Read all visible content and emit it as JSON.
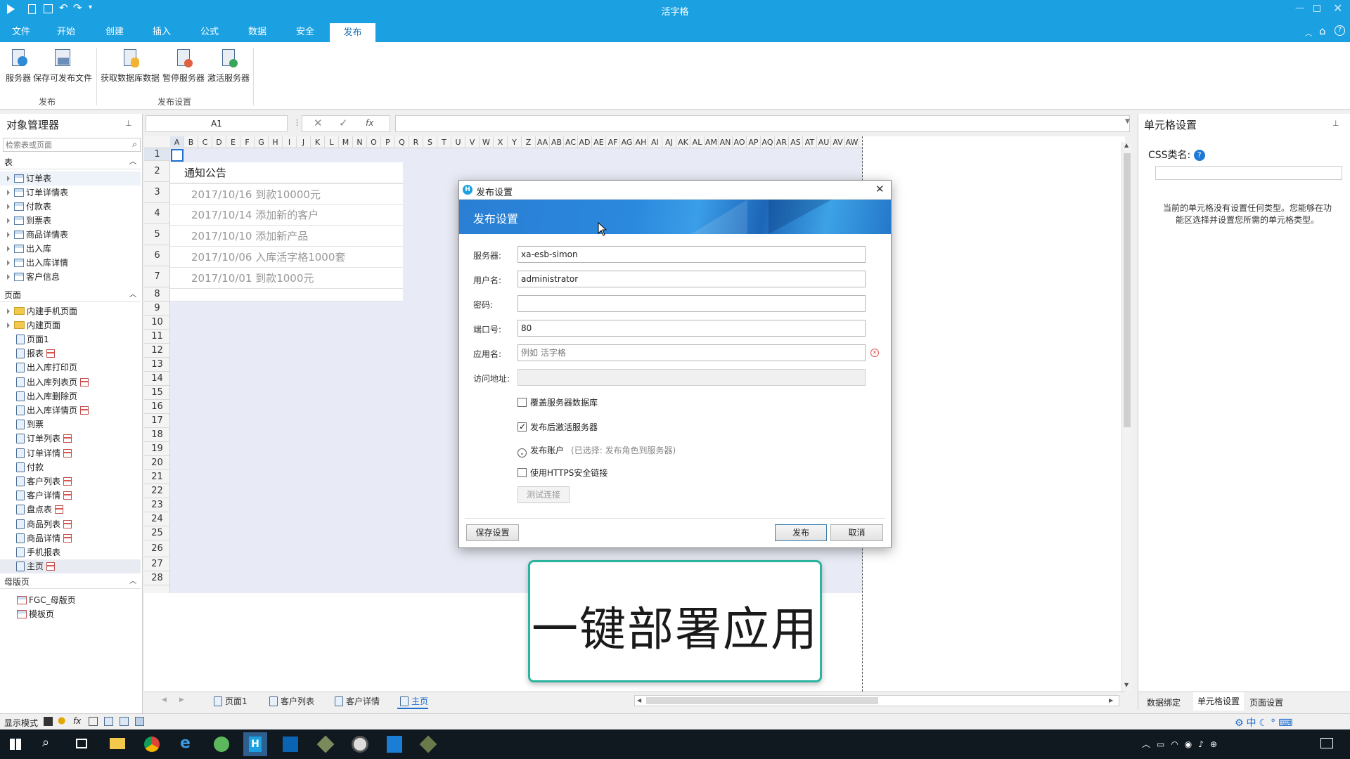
{
  "app": {
    "title": "活字格"
  },
  "ribbon": {
    "tabs": [
      "文件",
      "开始",
      "创建",
      "插入",
      "公式",
      "数据",
      "安全",
      "发布"
    ],
    "active_tab": "发布",
    "groups": [
      {
        "caption": "发布",
        "buttons": [
          "服务器",
          "保存可发布文件"
        ]
      },
      {
        "caption": "发布设置",
        "buttons": [
          "获取数据库数据",
          "暂停服务器",
          "激活服务器"
        ]
      }
    ]
  },
  "object_manager": {
    "title": "对象管理器",
    "search_placeholder": "检索表或页面",
    "sections": {
      "tables": {
        "label": "表",
        "items": [
          "订单表",
          "订单详情表",
          "付款表",
          "到票表",
          "商品详情表",
          "出入库",
          "出入库详情",
          "客户信息"
        ]
      },
      "pages": {
        "label": "页面",
        "folders": [
          "内建手机页面",
          "内建页面"
        ],
        "items": [
          {
            "label": "页面1",
            "report": false
          },
          {
            "label": "报表",
            "report": true
          },
          {
            "label": "出入库打印页",
            "report": false
          },
          {
            "label": "出入库列表页",
            "report": true
          },
          {
            "label": "出入库删除页",
            "report": false
          },
          {
            "label": "出入库详情页",
            "report": true
          },
          {
            "label": "到票",
            "report": false
          },
          {
            "label": "订单列表",
            "report": true
          },
          {
            "label": "订单详情",
            "report": true
          },
          {
            "label": "付款",
            "report": false
          },
          {
            "label": "客户列表",
            "report": true
          },
          {
            "label": "客户详情",
            "report": true
          },
          {
            "label": "盘点表",
            "report": true
          },
          {
            "label": "商品列表",
            "report": true
          },
          {
            "label": "商品详情",
            "report": true
          },
          {
            "label": "手机报表",
            "report": false
          },
          {
            "label": "主页",
            "report": true
          }
        ]
      },
      "masters": {
        "label": "母版页",
        "items": [
          "FGC_母版页",
          "模板页"
        ]
      }
    }
  },
  "formula_bar": {
    "cell_ref": "A1",
    "fx": "fx"
  },
  "sheet": {
    "columns": [
      "A",
      "B",
      "C",
      "D",
      "E",
      "F",
      "G",
      "H",
      "I",
      "J",
      "K",
      "L",
      "M",
      "N",
      "O",
      "P",
      "Q",
      "R",
      "S",
      "T",
      "U",
      "V",
      "W",
      "X",
      "Y",
      "Z",
      "AA",
      "AB",
      "AC",
      "AD",
      "AE",
      "AF",
      "AG",
      "AH",
      "AI",
      "AJ",
      "AK",
      "AL",
      "AM",
      "AN",
      "AO",
      "AP",
      "AQ",
      "AR",
      "AS",
      "AT",
      "AU",
      "AV",
      "AW"
    ],
    "rows": [
      "1",
      "2",
      "3",
      "4",
      "5",
      "6",
      "7",
      "8",
      "9",
      "10",
      "11",
      "12",
      "13",
      "14",
      "15",
      "16",
      "17",
      "18",
      "19",
      "20",
      "21",
      "22",
      "23",
      "24",
      "25",
      "26",
      "27",
      "28"
    ],
    "notice_title": "通知公告",
    "notices": [
      "2017/10/16 到款10000元",
      "2017/10/14 添加新的客户",
      "2017/10/10 添加新产品",
      "2017/10/06 入库活字格1000套",
      "2017/10/01 到款1000元"
    ]
  },
  "sheet_tabs": [
    "页面1",
    "客户列表",
    "客户详情",
    "主页"
  ],
  "active_sheet_tab": "主页",
  "right_panel": {
    "title": "单元格设置",
    "css_label": "CSS类名:",
    "hint": "当前的单元格没有设置任何类型。您能够在功能区选择并设置您所需的单元格类型。",
    "bottom_tabs": [
      "数据绑定",
      "单元格设置",
      "页面设置"
    ]
  },
  "status": {
    "mode_label": "显示模式"
  },
  "dialog": {
    "window_title": "发布设置",
    "banner_title": "发布设置",
    "fields": {
      "server": {
        "label": "服务器:",
        "value": "xa-esb-simon"
      },
      "username": {
        "label": "用户名:",
        "value": "administrator"
      },
      "password": {
        "label": "密码:",
        "value": ""
      },
      "port": {
        "label": "端口号:",
        "value": "80"
      },
      "appname": {
        "label": "应用名:",
        "placeholder": "例如 活字格"
      },
      "url": {
        "label": "访问地址:",
        "value": ""
      }
    },
    "overwrite_db": {
      "label": "覆盖服务器数据库",
      "checked": false
    },
    "activate_after": {
      "label": "发布后激活服务器",
      "checked": true
    },
    "publish_account": {
      "label": "发布账户",
      "note": "(已选择: 发布角色到服务器)"
    },
    "https": {
      "label": "使用HTTPS安全链接",
      "checked": false
    },
    "test_btn": "测试连接",
    "save_btn": "保存设置",
    "publish_btn": "发布",
    "cancel_btn": "取消"
  },
  "callout": {
    "text": "一键部署应用"
  },
  "colors": {
    "accent": "#1ba1e2",
    "banner": "#2a7fd4",
    "callout_border": "#2bb5a0"
  }
}
